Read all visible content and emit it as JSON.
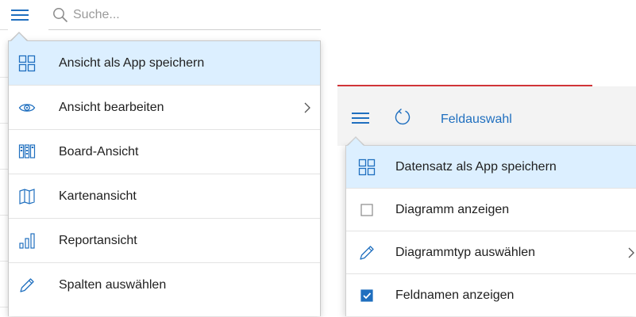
{
  "left": {
    "search": {
      "placeholder": "Suche..."
    },
    "menu": {
      "items": [
        {
          "label": "Ansicht als App speichern",
          "icon": "grid-icon",
          "active": true
        },
        {
          "label": "Ansicht bearbeiten",
          "icon": "eye-icon",
          "submenu": true
        },
        {
          "label": "Board-Ansicht",
          "icon": "board-icon"
        },
        {
          "label": "Kartenansicht",
          "icon": "map-icon"
        },
        {
          "label": "Reportansicht",
          "icon": "bar-chart-icon"
        },
        {
          "label": "Spalten auswählen",
          "icon": "pencil-icon"
        }
      ]
    }
  },
  "right": {
    "toolbar": {
      "field_selection": "Feldauswahl"
    },
    "menu": {
      "items": [
        {
          "label": "Datensatz als App speichern",
          "icon": "grid-icon",
          "active": true
        },
        {
          "label": "Diagramm anzeigen",
          "icon": "checkbox-icon",
          "checked": false
        },
        {
          "label": "Diagrammtyp auswählen",
          "icon": "pencil-icon",
          "submenu": true
        },
        {
          "label": "Feldnamen anzeigen",
          "icon": "checkbox-icon",
          "checked": true
        }
      ]
    }
  },
  "colors": {
    "accent": "#1f6fbf",
    "active_bg": "#dcefff",
    "alert_line": "#d13438",
    "toolbar_bg": "#f3f3f3"
  }
}
